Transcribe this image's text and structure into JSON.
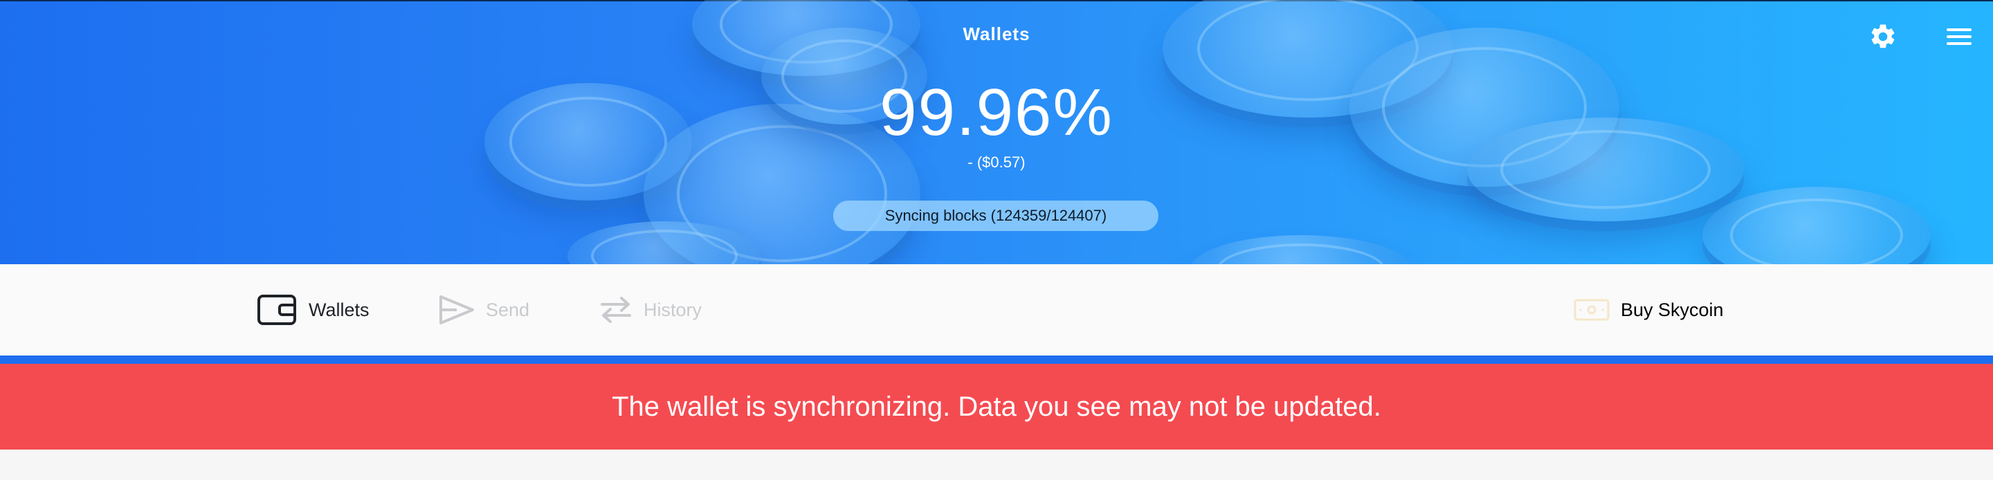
{
  "header": {
    "title": "Wallets",
    "balance": "99.96%",
    "fiat": "- ($0.57)",
    "sync_status": "Syncing blocks (124359/124407)",
    "icons": {
      "settings": "gear-icon",
      "menu": "hamburger-menu-icon"
    }
  },
  "nav": {
    "wallets_label": "Wallets",
    "send_label": "Send",
    "history_label": "History",
    "buy_label": "Buy Skycoin"
  },
  "banner": {
    "message": "The wallet is synchronizing. Data you see may not be updated."
  },
  "colors": {
    "header_gradient_start": "#1d6ff0",
    "header_gradient_end": "#25b5ff",
    "accent_underline": "#1d6ff0",
    "warning_banner": "#f44b51",
    "nav_active": "#1e2227",
    "nav_inactive": "#c8cacd"
  }
}
